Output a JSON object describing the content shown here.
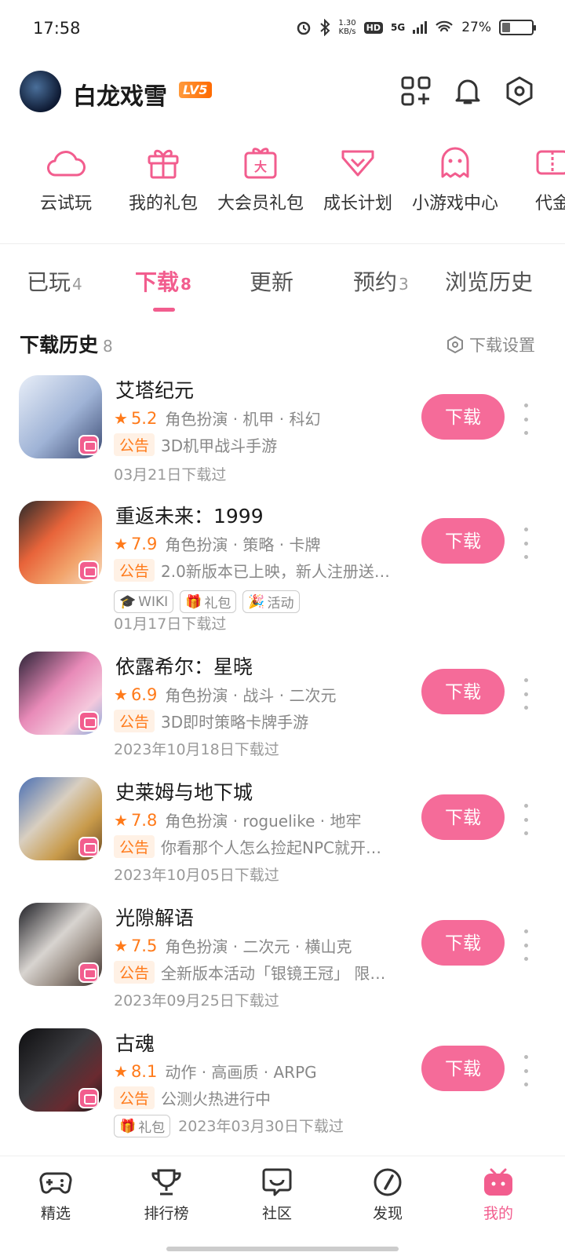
{
  "status_bar": {
    "time": "17:58",
    "net_speed_value": "1.30",
    "net_speed_unit": "KB/s",
    "hd": "HD",
    "signal": "5G",
    "battery": "27%",
    "battery_level": 0.27
  },
  "header": {
    "username": "白龙戏雪",
    "level": "LV5",
    "icons": [
      "apps-add-icon",
      "bell-icon",
      "settings-icon"
    ]
  },
  "quick_entries": [
    {
      "label": "云试玩",
      "icon": "cloud-icon"
    },
    {
      "label": "我的礼包",
      "icon": "gift-icon"
    },
    {
      "label": "大会员礼包",
      "icon": "vip-gift-icon"
    },
    {
      "label": "成长计划",
      "icon": "heart-badge-icon"
    },
    {
      "label": "小游戏中心",
      "icon": "ghost-icon"
    },
    {
      "label": "代金",
      "icon": "voucher-icon"
    }
  ],
  "tabs": [
    {
      "label": "已玩",
      "count": "4"
    },
    {
      "label": "下载",
      "count": "8"
    },
    {
      "label": "更新",
      "count": ""
    },
    {
      "label": "预约",
      "count": "3"
    },
    {
      "label": "浏览历史",
      "count": ""
    }
  ],
  "section": {
    "title": "下载历史",
    "count": "8",
    "settings_label": "下载设置"
  },
  "download_label": "下载",
  "notice_tag": "公告",
  "games": [
    {
      "name": "艾塔纪元",
      "score": "5.2",
      "genres": "角色扮演 · 机甲 · 科幻",
      "notice": "3D机甲战斗手游",
      "chips": [],
      "date": "03月21日下载过"
    },
    {
      "name": "重返未来：1999",
      "score": "7.9",
      "genres": "角色扮演 · 策略 · 卡牌",
      "notice": "2.0新版本已上映，新人注册送…",
      "chips": [
        "WIKI",
        "礼包",
        "活动"
      ],
      "date": "01月17日下载过"
    },
    {
      "name": "依露希尔：星晓",
      "score": "6.9",
      "genres": "角色扮演 · 战斗 · 二次元",
      "notice": "3D即时策略卡牌手游",
      "chips": [],
      "date": "2023年10月18日下载过"
    },
    {
      "name": "史莱姆与地下城",
      "score": "7.8",
      "genres": "角色扮演 · roguelike · 地牢",
      "notice": "你看那个人怎么捡起NPC就开…",
      "chips": [],
      "date": "2023年10月05日下载过"
    },
    {
      "name": "光隙解语",
      "score": "7.5",
      "genres": "角色扮演 · 二次元 · 横山克",
      "notice": "全新版本活动「银镜王冠」 限…",
      "chips": [],
      "date": "2023年09月25日下载过"
    },
    {
      "name": "古魂",
      "score": "8.1",
      "genres": "动作 · 高画质 · ARPG",
      "notice": "公测火热进行中",
      "chips": [
        "礼包"
      ],
      "date": "2023年03月30日下载过"
    }
  ],
  "bottom_nav": [
    {
      "label": "精选",
      "icon": "gamepad-icon"
    },
    {
      "label": "排行榜",
      "icon": "trophy-icon"
    },
    {
      "label": "社区",
      "icon": "chat-face-icon"
    },
    {
      "label": "发现",
      "icon": "compass-icon"
    },
    {
      "label": "我的",
      "icon": "tv-face-icon"
    }
  ],
  "colors": {
    "accent": "#f25d8e",
    "download_button": "#f56b99",
    "score": "#ff7a1a"
  }
}
